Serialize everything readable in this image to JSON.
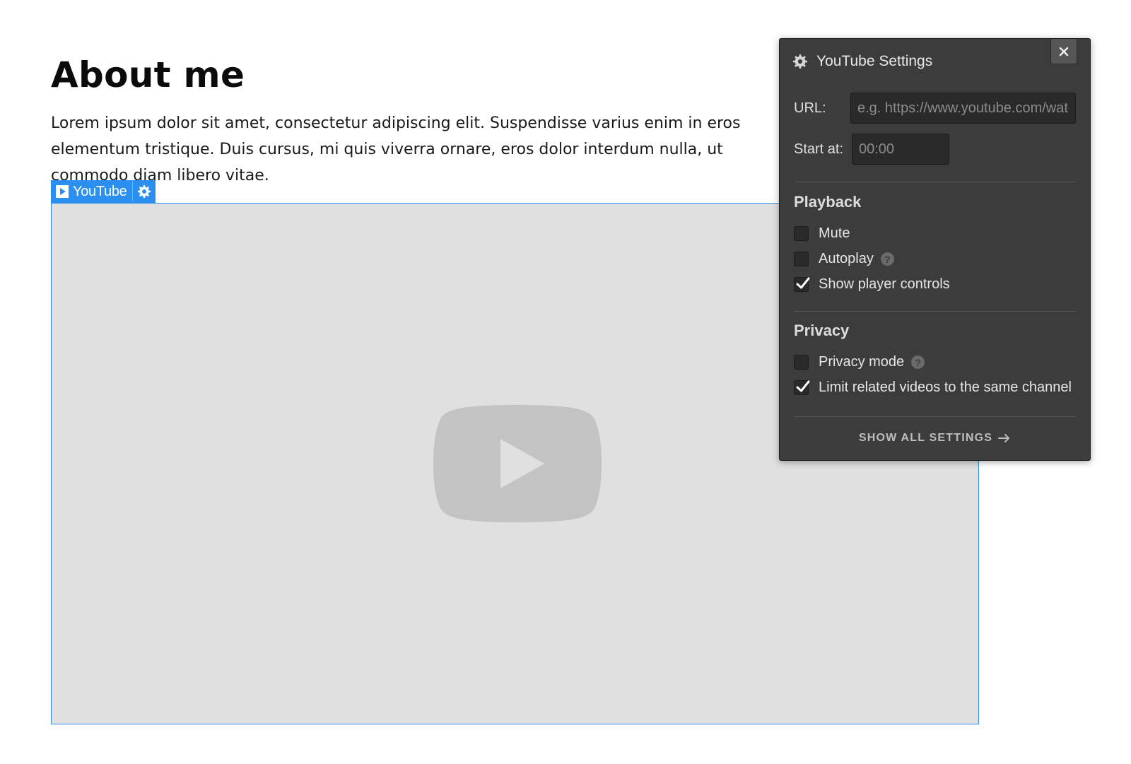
{
  "page": {
    "heading": "About me",
    "paragraph": "Lorem ipsum dolor sit amet, consectetur adipiscing elit. Suspendisse varius enim in eros elementum tristique. Duis cursus, mi quis viverra ornare, eros dolor interdum nulla, ut commodo diam libero vitae."
  },
  "element_toolbar": {
    "name": "YouTube",
    "icon": "youtube-element-icon",
    "settings_icon": "gear-icon",
    "accent_color": "#2b8ff0"
  },
  "video": {
    "placeholder_icon": "youtube-play-logo",
    "background_color": "#e0e0e0"
  },
  "settings_panel": {
    "title": "YouTube Settings",
    "title_icon": "gear-icon",
    "close_icon": "close-icon",
    "url_label": "URL:",
    "url_placeholder": "e.g. https://www.youtube.com/watch?v=",
    "url_value": "",
    "start_label": "Start at:",
    "start_placeholder": "00:00",
    "start_value": "",
    "playback": {
      "title": "Playback",
      "options": [
        {
          "label": "Mute",
          "checked": false,
          "help": false
        },
        {
          "label": "Autoplay",
          "checked": false,
          "help": true
        },
        {
          "label": "Show player controls",
          "checked": true,
          "help": false
        }
      ]
    },
    "privacy": {
      "title": "Privacy",
      "options": [
        {
          "label": "Privacy mode",
          "checked": false,
          "help": true
        },
        {
          "label": "Limit related videos to the same channel",
          "checked": true,
          "help": false
        }
      ]
    },
    "help_glyph": "?",
    "show_all_label": "SHOW ALL SETTINGS",
    "show_all_icon": "arrow-right-icon"
  }
}
